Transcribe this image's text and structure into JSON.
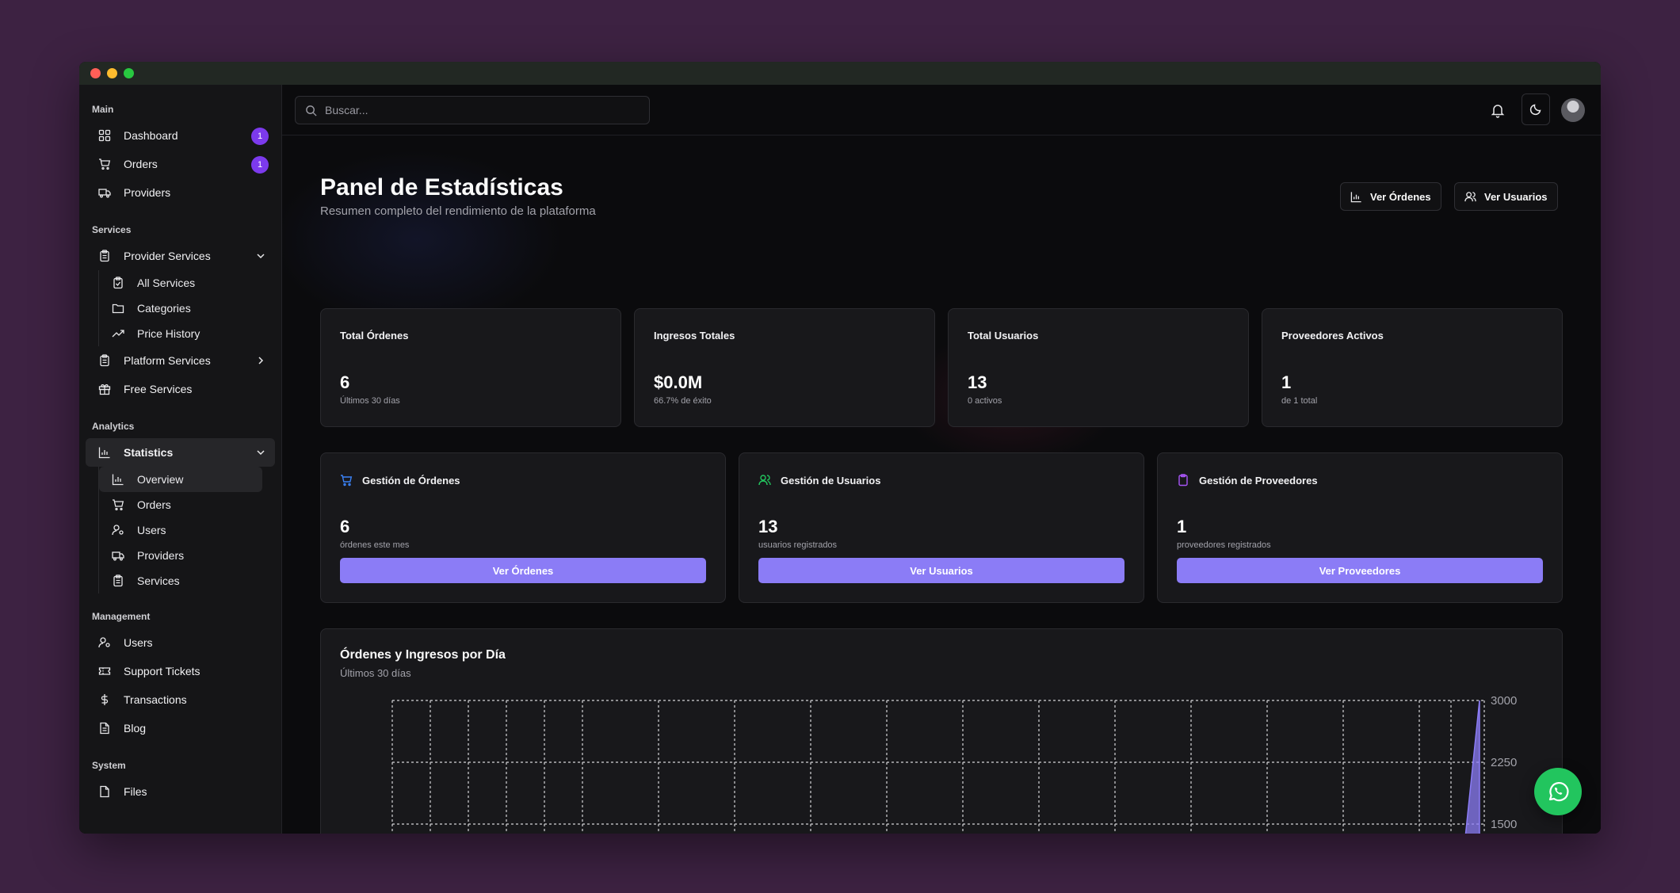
{
  "sidebar": {
    "main": {
      "title": "Main",
      "items": [
        {
          "label": "Dashboard",
          "badge": "1",
          "icon": "grid-icon"
        },
        {
          "label": "Orders",
          "badge": "1",
          "icon": "cart-icon"
        },
        {
          "label": "Providers",
          "icon": "truck-icon"
        }
      ]
    },
    "services": {
      "title": "Services",
      "provider_services": "Provider Services",
      "sub_items": [
        "All Services",
        "Categories",
        "Price History"
      ],
      "platform_services": "Platform Services",
      "free_services": "Free Services"
    },
    "analytics": {
      "title": "Analytics",
      "statistics": "Statistics",
      "sub_items": [
        "Overview",
        "Orders",
        "Users",
        "Providers",
        "Services"
      ]
    },
    "management": {
      "title": "Management",
      "items": [
        "Users",
        "Support Tickets",
        "Transactions",
        "Blog"
      ]
    },
    "system": {
      "title": "System",
      "items": [
        "Files"
      ]
    }
  },
  "topbar": {
    "search_placeholder": "Buscar..."
  },
  "header": {
    "title": "Panel de Estadísticas",
    "subtitle": "Resumen completo del rendimiento de la plataforma",
    "btn_orders": "Ver Órdenes",
    "btn_users": "Ver Usuarios"
  },
  "stats": [
    {
      "title": "Total Órdenes",
      "value": "6",
      "sub": "Últimos 30 días"
    },
    {
      "title": "Ingresos Totales",
      "value": "$0.0M",
      "sub": "66.7% de éxito"
    },
    {
      "title": "Total Usuarios",
      "value": "13",
      "sub": "0 activos"
    },
    {
      "title": "Proveedores Activos",
      "value": "1",
      "sub": "de 1 total"
    }
  ],
  "management": [
    {
      "title": "Gestión de Órdenes",
      "value": "6",
      "sub": "órdenes este mes",
      "button": "Ver Órdenes",
      "icon": "cart-icon",
      "color": "#3b82f6"
    },
    {
      "title": "Gestión de Usuarios",
      "value": "13",
      "sub": "usuarios registrados",
      "button": "Ver Usuarios",
      "icon": "users-icon",
      "color": "#22c55e"
    },
    {
      "title": "Gestión de Proveedores",
      "value": "1",
      "sub": "proveedores registrados",
      "button": "Ver Proveedores",
      "icon": "clipboard-icon",
      "color": "#a855f7"
    }
  ],
  "chart": {
    "title": "Órdenes y Ingresos por Día",
    "subtitle": "Últimos 30 días"
  },
  "chart_data": {
    "type": "area",
    "title": "Órdenes y Ingresos por Día",
    "y_ticks": [
      3000,
      2250,
      1500
    ],
    "ylim": [
      0,
      3000
    ],
    "series": [
      {
        "values": [
          0,
          0,
          0,
          0,
          0,
          0,
          0,
          0,
          0,
          0,
          0,
          0,
          0,
          0,
          0,
          0,
          0,
          0,
          0,
          0,
          0,
          0,
          0,
          0,
          0,
          0,
          0,
          0,
          0,
          3000
        ],
        "color": "#8b7cf6"
      }
    ],
    "grid": true
  },
  "colors": {
    "accent": "#8b7cf6",
    "badge": "#7c3aed",
    "whatsapp": "#22c55e"
  }
}
